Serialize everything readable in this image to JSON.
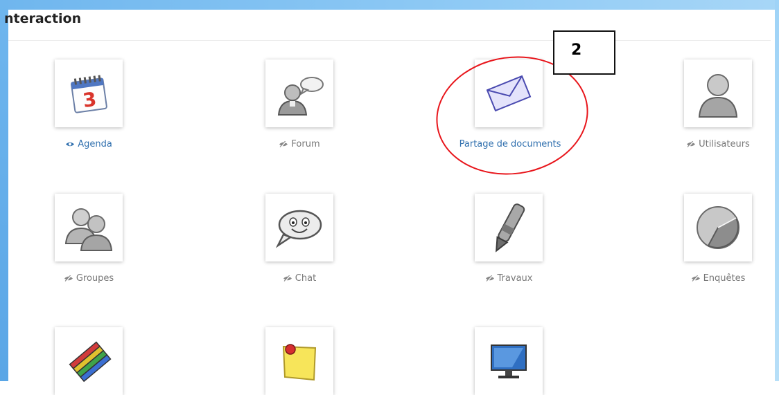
{
  "section": {
    "title": "nteraction"
  },
  "callout": {
    "number": "2"
  },
  "tools": [
    {
      "label": "Agenda",
      "icon": "calendar-icon",
      "visible": true
    },
    {
      "label": "Forum",
      "icon": "forum-icon",
      "visible": false
    },
    {
      "label": "Partage de documents",
      "icon": "envelope-icon",
      "visible": true
    },
    {
      "label": "Utilisateurs",
      "icon": "user-icon",
      "visible": false
    },
    {
      "label": "Groupes",
      "icon": "group-icon",
      "visible": false
    },
    {
      "label": "Chat",
      "icon": "chat-icon",
      "visible": false
    },
    {
      "label": "Travaux",
      "icon": "pen-icon",
      "visible": false
    },
    {
      "label": "Enquêtes",
      "icon": "pie-chart-icon",
      "visible": false
    },
    {
      "label": "",
      "icon": "pencils-icon",
      "visible": false
    },
    {
      "label": "",
      "icon": "sticky-note-icon",
      "visible": false
    },
    {
      "label": "",
      "icon": "monitor-icon",
      "visible": false
    }
  ],
  "colors": {
    "visible_link": "#2f6fae",
    "hidden_link": "#777777",
    "highlight_ring": "#e8151b",
    "accent_strip": "#6fb6ee"
  }
}
